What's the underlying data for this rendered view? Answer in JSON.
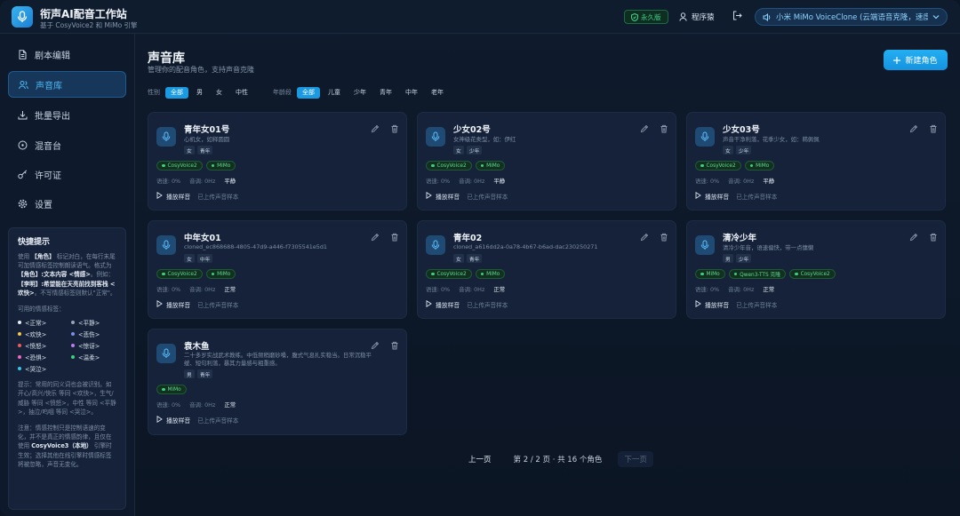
{
  "app": {
    "title": "衔声AI配音工作站",
    "subtitle": "基于 CosyVoice2 和 MiMo 引擎"
  },
  "header": {
    "license_badge": "永久版",
    "username": "程序猿",
    "engine_selected": "小米 MiMo VoiceClone (云端语音克隆，速度快)"
  },
  "sidebar": {
    "items": [
      {
        "label": "剧本编辑",
        "icon": "document-icon",
        "active": false
      },
      {
        "label": "声音库",
        "icon": "users-icon",
        "active": true
      },
      {
        "label": "批量导出",
        "icon": "download-icon",
        "active": false
      },
      {
        "label": "混音台",
        "icon": "disc-icon",
        "active": false
      },
      {
        "label": "许可证",
        "icon": "key-icon",
        "active": false
      },
      {
        "label": "设置",
        "icon": "gear-icon",
        "active": false
      }
    ],
    "tips": {
      "title": "快捷提示",
      "p1_a": "使用",
      "p1_b": "【角色】",
      "p1_c": "标记对白，在每行末尾可加情感标签控制朗读语气。格式为",
      "p1_d": "【角色】:文本内容 <情感>",
      "p1_e": "。例如：",
      "p1_f": "【李明】:希望能在天亮前找到客栈 <欢快>",
      "p1_g": "。不写情感标签则默认\"正常\"。",
      "emotions_title": "可用的情感标签：",
      "emotions": [
        {
          "label": "<正常>",
          "color": "#e8eef6"
        },
        {
          "label": "<平静>",
          "color": "#9aa6b6"
        },
        {
          "label": "<欢快>",
          "color": "#f2c94c"
        },
        {
          "label": "<悲伤>",
          "color": "#7b8fe8"
        },
        {
          "label": "<愤怒>",
          "color": "#f05b5b"
        },
        {
          "label": "<惊讶>",
          "color": "#c07cf0"
        },
        {
          "label": "<恐惧>",
          "color": "#f06ac0"
        },
        {
          "label": "<温柔>",
          "color": "#3fd07c"
        },
        {
          "label": "<哭泣>",
          "color": "#34c6e8"
        }
      ],
      "p2": "提示：常用的同义词也会被识别。如 开心/高兴/快乐 等同 <欢快>，生气/威胁 等同 <愤怒>，中性 等同 <平静>，抽泣/呜咽 等同 <哭泣>。",
      "p3_a": "注意：情感控制只是控制语速的变化，并不是真正的情感韵律，且仅在使用",
      "p3_b": "CosyVoice3（本地）",
      "p3_c": "引擎时生效；选择其他在线引擎时情感标签将被忽略，声音无变化。"
    }
  },
  "main": {
    "title": "声音库",
    "subtitle": "管理你的配音角色，支持声音克隆",
    "new_button": "新建角色",
    "filters": {
      "gender_label": "性别",
      "gender": [
        {
          "label": "全部",
          "active": true
        },
        {
          "label": "男",
          "active": false
        },
        {
          "label": "女",
          "active": false
        },
        {
          "label": "中性",
          "active": false
        }
      ],
      "age_label": "年龄段",
      "age": [
        {
          "label": "全部",
          "active": true
        },
        {
          "label": "儿童",
          "active": false
        },
        {
          "label": "少年",
          "active": false
        },
        {
          "label": "青年",
          "active": false
        },
        {
          "label": "中年",
          "active": false
        },
        {
          "label": "老年",
          "active": false
        }
      ]
    },
    "cards": [
      {
        "name": "青年女01号",
        "desc": "心机女，如释圆圆",
        "tags": [
          "女",
          "青年"
        ],
        "engines": [
          "CosyVoice2",
          "MiMo"
        ],
        "speed": "语速: 0%",
        "pitch": "音调: 0Hz",
        "mood": "平静",
        "play": "播放样音",
        "uploaded": "已上传声音样本"
      },
      {
        "name": "少女02号",
        "desc": "女神级花类型，如：伊红",
        "tags": [
          "女",
          "少年"
        ],
        "engines": [
          "CosyVoice2",
          "MiMo"
        ],
        "speed": "语速: 0%",
        "pitch": "音调: 0Hz",
        "mood": "平静",
        "play": "播放样音",
        "uploaded": "已上传声音样本"
      },
      {
        "name": "少女03号",
        "desc": "声音干净利落，花季少女，如：韩佩佩",
        "tags": [
          "女",
          "少年"
        ],
        "engines": [
          "CosyVoice2",
          "MiMo"
        ],
        "speed": "语速: 0%",
        "pitch": "音调: 0Hz",
        "mood": "平静",
        "play": "播放样音",
        "uploaded": "已上传声音样本"
      },
      {
        "name": "中年女01",
        "desc": "cloned_ec868688-4805-47d9-a446-f7305541e5d1",
        "tags": [
          "女",
          "中年"
        ],
        "engines": [
          "CosyVoice2",
          "MiMo"
        ],
        "speed": "语速: 0%",
        "pitch": "音调: 0Hz",
        "mood": "正常",
        "play": "播放样音",
        "uploaded": "已上传声音样本"
      },
      {
        "name": "青年02",
        "desc": "cloned_a616dd2a-0a78-4b67-b6ad-dac230250271",
        "tags": [
          "女",
          "青年"
        ],
        "engines": [
          "CosyVoice2",
          "MiMo"
        ],
        "speed": "语速: 0%",
        "pitch": "音调: 0Hz",
        "mood": "正常",
        "play": "播放样音",
        "uploaded": "已上传声音样本"
      },
      {
        "name": "清冷少年",
        "desc": "清冷少年音，语速偏快，带一点慵懒",
        "tags": [
          "男",
          "少年"
        ],
        "engines": [
          "MiMo",
          "Qwen3-TTS 克隆",
          "CosyVoice2"
        ],
        "speed": "语速: 0%",
        "pitch": "音调: 0Hz",
        "mood": "正常",
        "play": "播放样音",
        "uploaded": "已上传声音样本"
      },
      {
        "name": "袁木鱼",
        "desc": "二十多岁实战武术教练。中低频稍磨砂嗓，腹式气息扎实稳当。日常沉稳平缓、短句利落，暴其力量感与粗重感。",
        "tags": [
          "男",
          "青年"
        ],
        "engines": [
          "MiMo"
        ],
        "speed": "语速: 0%",
        "pitch": "音调: 0Hz",
        "mood": "正常",
        "play": "播放样音",
        "uploaded": "已上传声音样本"
      }
    ],
    "pager": {
      "prev": "上一页",
      "info": "第 2 / 2 页 · 共 16 个角色",
      "next": "下一页"
    }
  }
}
